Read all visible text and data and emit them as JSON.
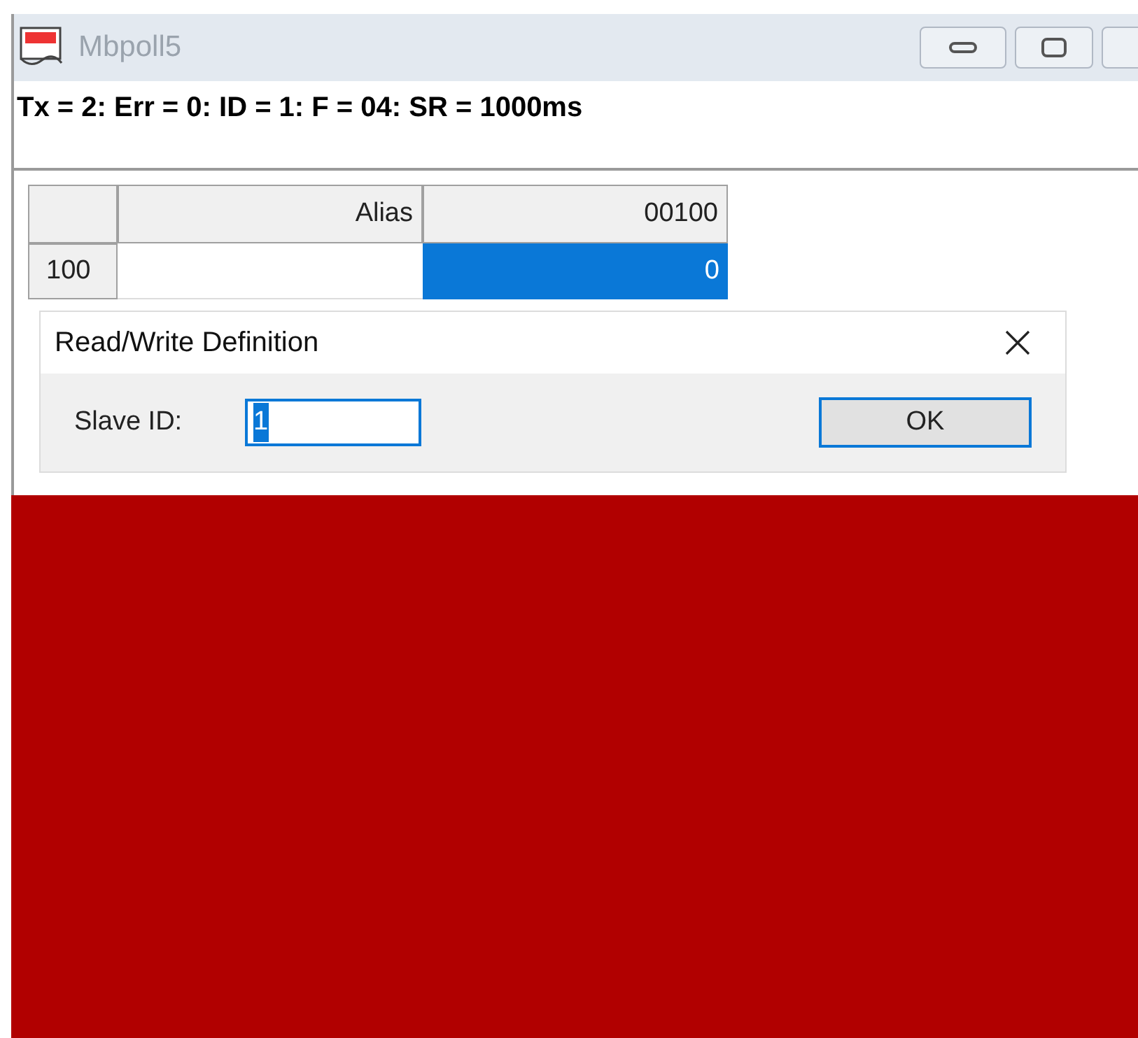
{
  "window": {
    "title": "Mbpoll5"
  },
  "status_line": "Tx = 2: Err = 0: ID = 1: F = 04: SR = 1000ms",
  "grid": {
    "columns": [
      "Alias",
      "00100"
    ],
    "rows": [
      {
        "header": "100",
        "value": "0",
        "selected": true
      }
    ]
  },
  "dialog": {
    "title": "Read/Write Definition",
    "fields": [
      {
        "label": "Slave ID:",
        "value": "1",
        "text_selected": true
      }
    ],
    "ok_button": "OK"
  }
}
